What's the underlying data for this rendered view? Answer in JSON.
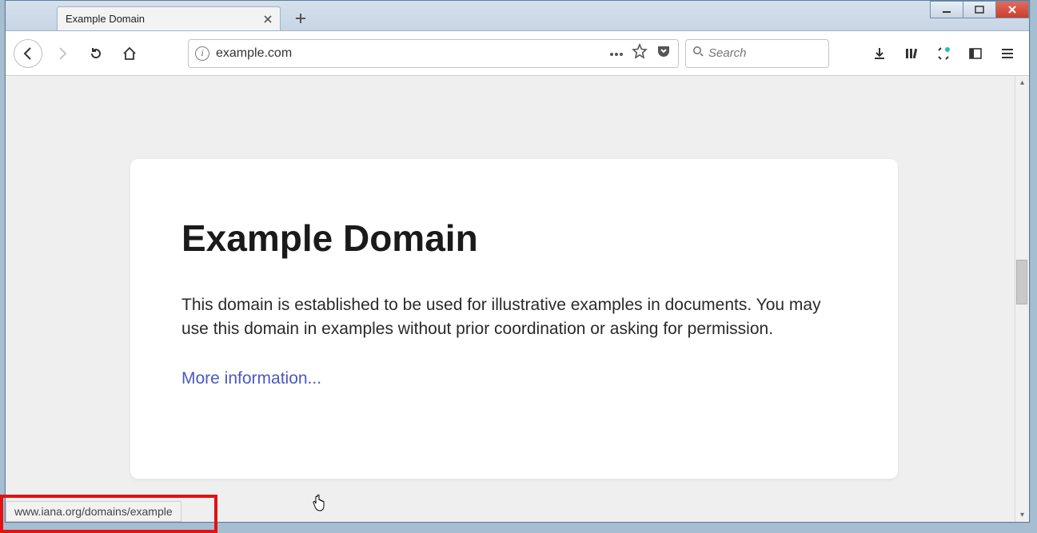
{
  "tab": {
    "title": "Example Domain"
  },
  "urlbar": {
    "url": "example.com"
  },
  "searchbox": {
    "placeholder": "Search"
  },
  "page": {
    "heading": "Example Domain",
    "paragraph": "This domain is established to be used for illustrative examples in documents. You may use this domain in examples without prior coordination or asking for permission.",
    "link_text": "More information..."
  },
  "status": {
    "hover_url": "www.iana.org/domains/example"
  }
}
